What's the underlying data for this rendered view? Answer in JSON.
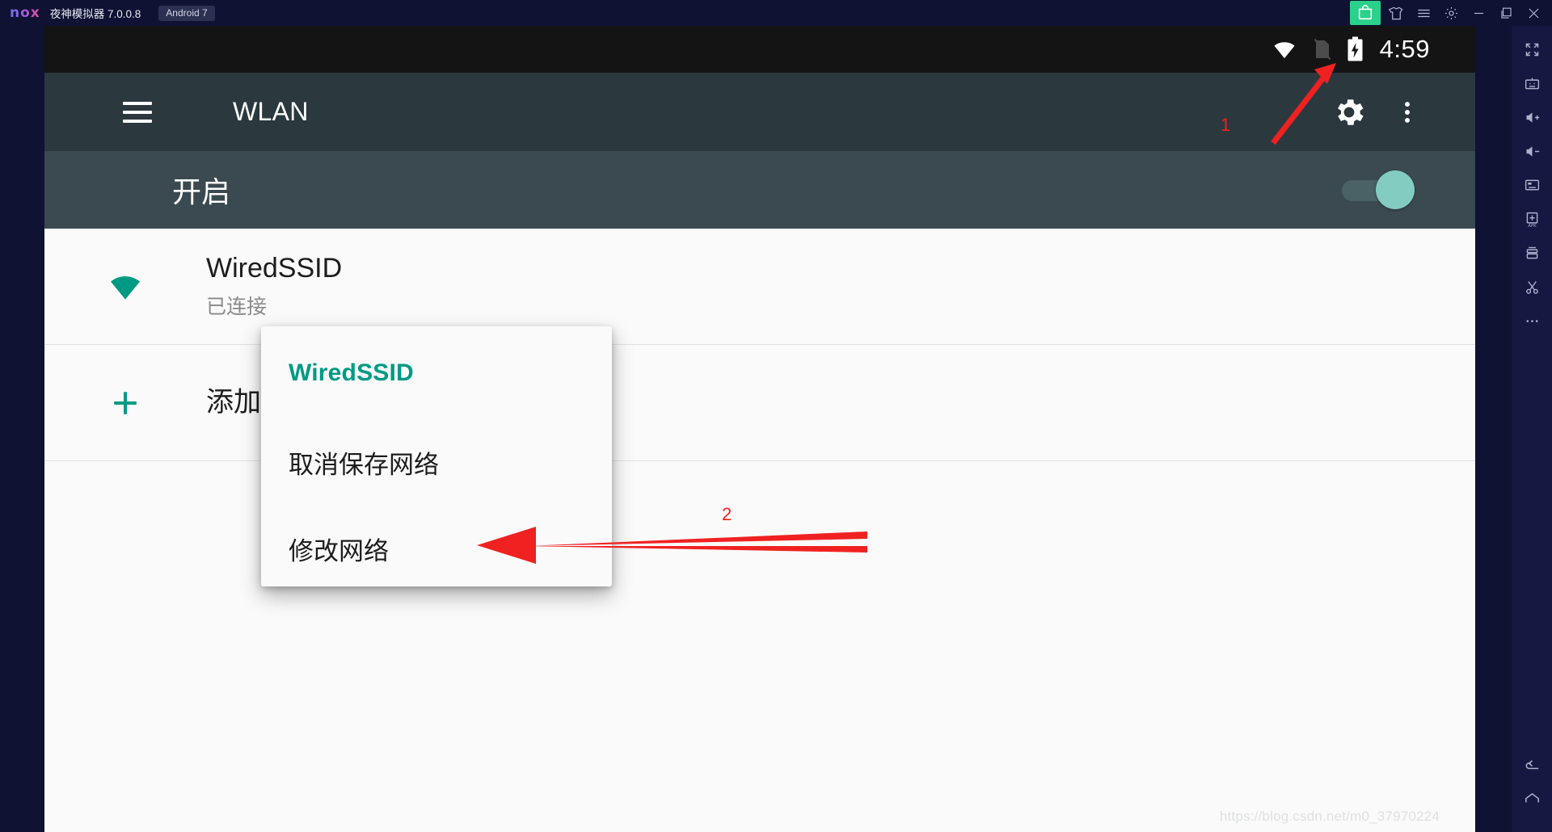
{
  "window": {
    "logo": "nox",
    "title": "夜神模拟器 7.0.0.8",
    "android_badge": "Android 7",
    "controls": [
      {
        "name": "app-store",
        "icon": "store-icon"
      },
      {
        "name": "theme",
        "icon": "shirt-icon"
      },
      {
        "name": "menu",
        "icon": "hamburger-icon"
      },
      {
        "name": "settings",
        "icon": "gear-icon"
      },
      {
        "name": "minimize",
        "icon": "minimize-icon"
      },
      {
        "name": "restore",
        "icon": "restore-icon"
      },
      {
        "name": "close",
        "icon": "close-icon"
      }
    ]
  },
  "sidebar": {
    "items": [
      {
        "name": "fullscreen",
        "icon": "fullscreen-icon"
      },
      {
        "name": "keyboard",
        "icon": "keyboard-icon"
      },
      {
        "name": "volume-up",
        "icon": "volume-up-icon"
      },
      {
        "name": "volume-down",
        "icon": "volume-down-icon"
      },
      {
        "name": "screenshot",
        "icon": "monitor-icon"
      },
      {
        "name": "install-apk",
        "icon": "apk-install-icon"
      },
      {
        "name": "multi-instance",
        "icon": "multi-instance-icon"
      },
      {
        "name": "scissors",
        "icon": "scissors-icon"
      },
      {
        "name": "more",
        "icon": "ellipsis-icon"
      }
    ],
    "bottom_items": [
      {
        "name": "back",
        "icon": "back-arrow-icon"
      },
      {
        "name": "home",
        "icon": "home-icon"
      }
    ]
  },
  "statusbar": {
    "wifi_icon": "wifi-full-icon",
    "sim_icon": "sim-off-icon",
    "battery_icon": "battery-charging-icon",
    "time": "4:59"
  },
  "appbar": {
    "menu_icon": "hamburger-icon",
    "title": "WLAN",
    "settings_icon": "gear-icon",
    "overflow_icon": "overflow-menu-icon"
  },
  "master_switch": {
    "label": "开启",
    "state": "on"
  },
  "networks": [
    {
      "icon": "wifi-signal-icon",
      "ssid": "WiredSSID",
      "status": "已连接",
      "accent": "#009a84"
    }
  ],
  "add_network": {
    "icon": "plus-icon",
    "label": "添加网络"
  },
  "dialog": {
    "title": "WiredSSID",
    "title_color": "#009a84",
    "items": [
      {
        "label": "取消保存网络"
      },
      {
        "label": "修改网络"
      }
    ]
  },
  "annotations": [
    {
      "label": "1",
      "color": "#f02121",
      "target": "wifi-status-icon"
    },
    {
      "label": "2",
      "color": "#f02121",
      "target": "dialog-item-modify-network"
    }
  ],
  "watermark": "https://blog.csdn.net/m0_37970224",
  "colors": {
    "frame": "#0f1232",
    "sidebar": "#151841",
    "appbar": "#2b383e",
    "switchrow": "#3b4a51",
    "content": "#fafafa",
    "accent": "#009a84",
    "toggle_thumb": "#83ccc2",
    "annotation": "#f02121"
  }
}
